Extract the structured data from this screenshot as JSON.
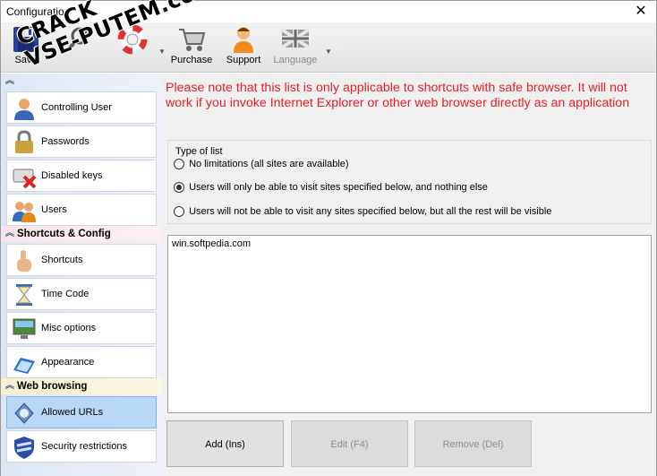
{
  "window": {
    "title": "Configuration"
  },
  "toolbar": {
    "save_label": "Save",
    "purchase_label": "Purchase",
    "support_label": "Support",
    "language_label": "Language"
  },
  "watermark": {
    "line1": "CRACK",
    "line2": "VSE-PUTEM.com"
  },
  "sidebar": {
    "sections": [
      {
        "title": "",
        "items": [
          {
            "label": "Controlling User",
            "icon": "controlling-user-icon"
          },
          {
            "label": "Passwords",
            "icon": "padlock-icon"
          },
          {
            "label": "Disabled keys",
            "icon": "keyboard-disabled-icon"
          },
          {
            "label": "Users",
            "icon": "users-icon"
          }
        ]
      },
      {
        "title": "Shortcuts & Config",
        "items": [
          {
            "label": "Shortcuts",
            "icon": "hand-pointer-icon"
          },
          {
            "label": "Time Code",
            "icon": "hourglass-icon"
          },
          {
            "label": "Misc options",
            "icon": "monitor-icon"
          },
          {
            "label": "Appearance",
            "icon": "laptop-pen-icon"
          }
        ]
      },
      {
        "title": "Web browsing",
        "items": [
          {
            "label": "Allowed URLs",
            "icon": "globe-arrow-icon",
            "selected": true
          },
          {
            "label": "Security restrictions",
            "icon": "shield-icon"
          }
        ]
      }
    ]
  },
  "main": {
    "notice": "Please note that this list is only applicable to shortcuts with safe browser. It will not work if you invoke Internet Explorer or other web browser directly as an application",
    "type_of_list": {
      "title": "Type of list",
      "options": [
        {
          "label": "No limitations (all sites are available)",
          "checked": false
        },
        {
          "label": "Users will only be able to visit sites specified below, and nothing else",
          "checked": true
        },
        {
          "label": "Users will not be able to visit any sites specified below, but all the rest will be visible",
          "checked": false
        }
      ]
    },
    "urls": [
      "win.softpedia.com"
    ],
    "buttons": {
      "add": "Add (Ins)",
      "edit": "Edit (F4)",
      "remove": "Remove (Del)"
    }
  },
  "colors": {
    "notice": "#e0202a",
    "selected_item": "#b9d8f7"
  }
}
